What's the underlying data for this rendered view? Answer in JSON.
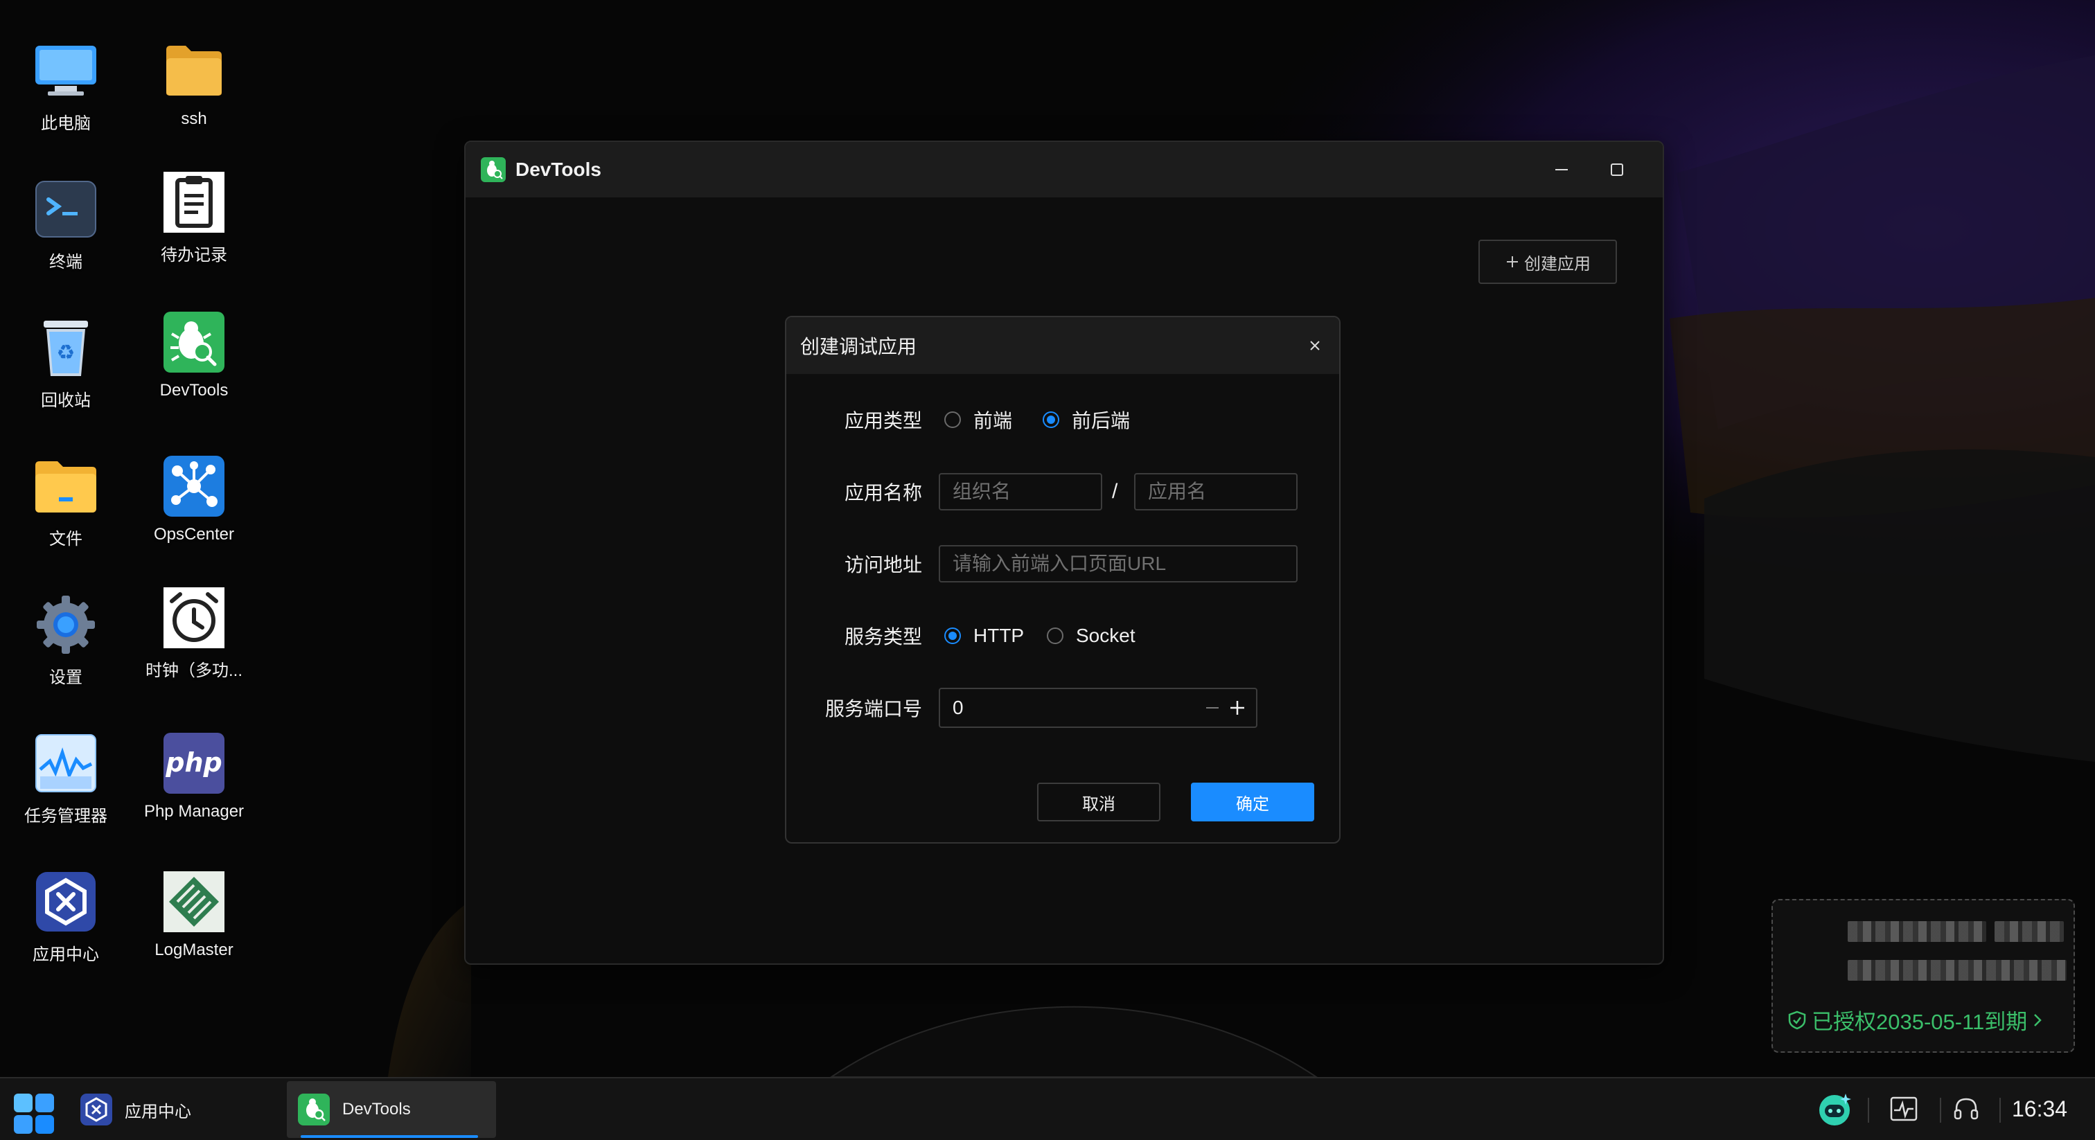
{
  "desktop": {
    "icons": [
      {
        "label": "此电脑",
        "icon": "computer-icon"
      },
      {
        "label": "ssh",
        "icon": "folder-icon"
      },
      {
        "label": "终端",
        "icon": "terminal-icon"
      },
      {
        "label": "待办记录",
        "icon": "clipboard-icon"
      },
      {
        "label": "回收站",
        "icon": "recycle-bin-icon"
      },
      {
        "label": "DevTools",
        "icon": "devtools-bug-icon"
      },
      {
        "label": "文件",
        "icon": "file-manager-icon"
      },
      {
        "label": "OpsCenter",
        "icon": "opscenter-icon"
      },
      {
        "label": "设置",
        "icon": "settings-gear-icon"
      },
      {
        "label": "时钟（多功...",
        "icon": "alarm-clock-icon"
      },
      {
        "label": "任务管理器",
        "icon": "task-manager-icon"
      },
      {
        "label": "Php Manager",
        "icon": "php-icon"
      },
      {
        "label": "应用中心",
        "icon": "app-center-icon"
      },
      {
        "label": "LogMaster",
        "icon": "logmaster-icon"
      }
    ]
  },
  "window": {
    "title": "DevTools",
    "create_button": "创建应用"
  },
  "dialog": {
    "title": "创建调试应用",
    "app_type_label": "应用类型",
    "app_type_options": [
      "前端",
      "前后端"
    ],
    "app_type_selected": "前后端",
    "app_name_label": "应用名称",
    "org_placeholder": "组织名",
    "separator": "/",
    "app_placeholder": "应用名",
    "url_label": "访问地址",
    "url_placeholder": "请输入前端入口页面URL",
    "service_type_label": "服务类型",
    "service_type_options": [
      "HTTP",
      "Socket"
    ],
    "service_type_selected": "HTTP",
    "port_label": "服务端口号",
    "port_value": "0",
    "cancel": "取消",
    "ok": "确定"
  },
  "license": {
    "text": "已授权2035-05-11到期"
  },
  "taskbar": {
    "items": [
      "应用中心",
      "DevTools"
    ],
    "active": "DevTools",
    "clock": "16:34"
  },
  "colors": {
    "accent": "#1a8cff",
    "license_green": "#3bbf6a",
    "devtools_green": "#2fb45a"
  }
}
